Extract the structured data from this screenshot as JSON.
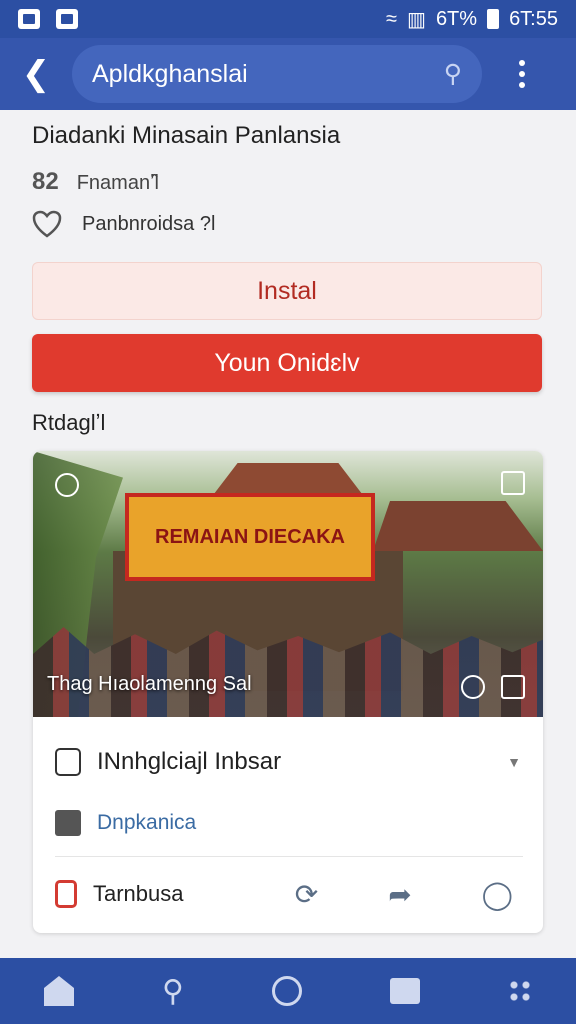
{
  "status_bar": {
    "battery": "6T%",
    "time": "6T:55"
  },
  "app_bar": {
    "search_query": "Apldkghanslai"
  },
  "place": {
    "title": "Diadanki Minasain Panlansia",
    "rating_number": "82",
    "rating_label": "Fnamanʼ̂l",
    "favorite_label": "Panbnroidsa ?l"
  },
  "buttons": {
    "install": "Instal",
    "primary": "Youn Onidɛlv"
  },
  "section_label": "Rtdaglʼl",
  "photo": {
    "banner_text": "REMAIAN DIECAKA",
    "caption": "Thag Hıaolamenng Sal"
  },
  "rows": {
    "row1_label": "INnhglciajl Inbsar",
    "row2_label": "Dnpkanica",
    "row3_label": "Tarnbusa"
  }
}
